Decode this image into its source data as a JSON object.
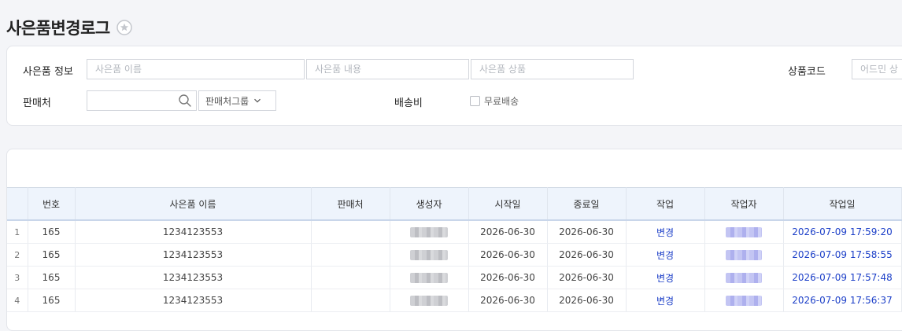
{
  "page": {
    "title": "사은품변경로그"
  },
  "filters": {
    "gift_info_label": "사은품 정보",
    "gift_name_placeholder": "사은품 이름",
    "gift_content_placeholder": "사은품 내용",
    "gift_product_placeholder": "사은품 상품",
    "product_code_label": "상품코드",
    "admin_code_placeholder": "어드민 상",
    "seller_label": "판매처",
    "seller_input_value": "",
    "seller_group_label": "판매처그룹",
    "shipping_label": "배송비",
    "free_shipping_label": "무료배송"
  },
  "table": {
    "columns": [
      "번호",
      "사은품 이름",
      "판매처",
      "생성자",
      "시작일",
      "종료일",
      "작업",
      "작업자",
      "작업일"
    ],
    "rows": [
      {
        "idx": "1",
        "no": "165",
        "name": "1234123553",
        "seller": "",
        "start": "2026-06-30",
        "end": "2026-06-30",
        "action": "변경",
        "worked_at": "2026-07-09 17:59:20"
      },
      {
        "idx": "2",
        "no": "165",
        "name": "1234123553",
        "seller": "",
        "start": "2026-06-30",
        "end": "2026-06-30",
        "action": "변경",
        "worked_at": "2026-07-09 17:58:55"
      },
      {
        "idx": "3",
        "no": "165",
        "name": "1234123553",
        "seller": "",
        "start": "2026-06-30",
        "end": "2026-06-30",
        "action": "변경",
        "worked_at": "2026-07-09 17:57:48"
      },
      {
        "idx": "4",
        "no": "165",
        "name": "1234123553",
        "seller": "",
        "start": "2026-06-30",
        "end": "2026-06-30",
        "action": "변경",
        "worked_at": "2026-07-09 17:56:37"
      }
    ]
  },
  "icons": {
    "favorite": "star-icon",
    "search": "search-icon",
    "dropdown": "chevron-down-icon"
  },
  "colors": {
    "link": "#1c3fc8",
    "header_bg": "#eef4fc"
  }
}
